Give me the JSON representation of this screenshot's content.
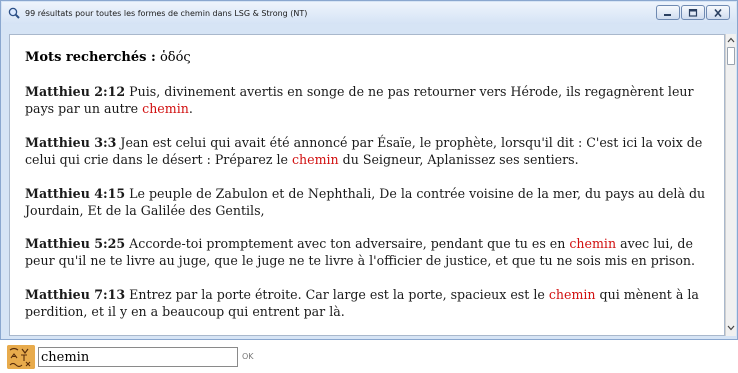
{
  "window": {
    "title": "99 résultats pour toutes les formes de chemin dans LSG & Strong (NT)"
  },
  "search_header": {
    "label": "Mots recherchés :",
    "term": "ὁδός"
  },
  "results": [
    {
      "ref": "Matthieu 2:12",
      "before": " Puis, divinement avertis en songe de ne pas retourner vers Hérode, ils regagnèrent leur pays par un autre ",
      "highlight": "chemin",
      "after": "."
    },
    {
      "ref": "Matthieu 3:3",
      "before": " Jean est celui qui avait été annoncé par Ésaïe, le prophète, lorsqu'il dit : C'est ici la voix de celui qui crie dans le désert : Préparez le ",
      "highlight": "chemin",
      "after": " du Seigneur, Aplanissez ses sentiers."
    },
    {
      "ref": "Matthieu 4:15",
      "before": " Le peuple de Zabulon et de Nephthali, De la contrée voisine de la mer, du pays au delà du Jourdain, Et de la Galilée des Gentils,",
      "highlight": "",
      "after": ""
    },
    {
      "ref": "Matthieu 5:25",
      "before": " Accorde-toi promptement avec ton adversaire, pendant que tu es en ",
      "highlight": "chemin",
      "after": " avec lui, de peur qu'il ne te livre au juge, que le juge ne te livre à l'officier de justice, et que tu ne sois mis en prison."
    },
    {
      "ref": "Matthieu 7:13",
      "before": " Entrez par la porte étroite. Car large est la porte, spacieux est le ",
      "highlight": "chemin",
      "after": " qui mènent à la perdition, et il y en a beaucoup qui entrent par là."
    }
  ],
  "search_bar": {
    "value": "chemin",
    "ok_label": "OK"
  },
  "colors": {
    "highlight": "#d11010",
    "titlebar": "#d6e4f5"
  },
  "icons": {
    "title": "magnifier-icon",
    "minimize": "minimize-icon",
    "maximize": "maximize-icon",
    "close": "close-icon",
    "app": "lexicon-app-icon"
  }
}
